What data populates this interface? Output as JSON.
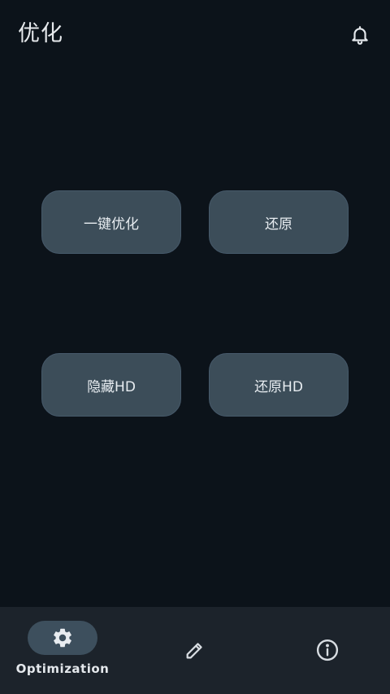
{
  "header": {
    "title": "优化",
    "notification_icon": "bell-icon"
  },
  "actions": {
    "optimize_label": "一键优化",
    "restore_label": "还原",
    "hide_hd_label": "隐藏HD",
    "restore_hd_label": "还原HD"
  },
  "bottom_nav": {
    "items": [
      {
        "icon": "gear-icon",
        "label": "Optimization",
        "selected": true
      },
      {
        "icon": "pencil-icon",
        "label": "",
        "selected": false
      },
      {
        "icon": "info-icon",
        "label": "",
        "selected": false
      }
    ]
  },
  "colors": {
    "background": "#0c131a",
    "button": "#3c4d59",
    "nav_background": "#1c232b",
    "nav_pill": "#3d4f5d",
    "text": "#e2e6ea"
  }
}
